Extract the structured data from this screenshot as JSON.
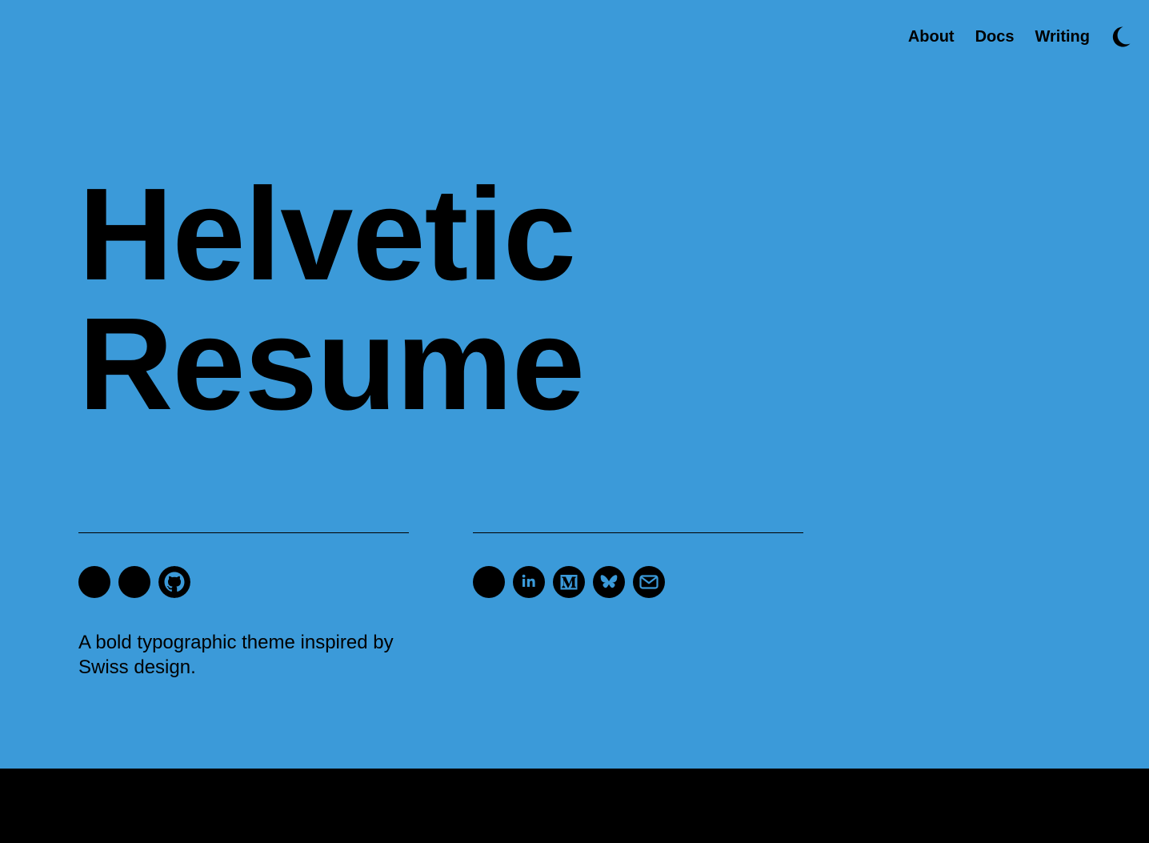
{
  "nav": {
    "items": [
      {
        "label": "About"
      },
      {
        "label": "Docs"
      },
      {
        "label": "Writing"
      }
    ],
    "theme_toggle_icon": "moon-icon"
  },
  "hero": {
    "line1": "Helvetic",
    "line2": "Resume"
  },
  "left_section": {
    "icons": [
      "circle-icon",
      "circle-icon",
      "github-icon"
    ],
    "tagline": "A bold typographic theme inspired by Swiss design."
  },
  "right_section": {
    "icons": [
      "circle-icon",
      "linkedin-icon",
      "medium-icon",
      "bluesky-icon",
      "mail-icon"
    ]
  },
  "colors": {
    "background": "#3b9ad9",
    "text": "#000000",
    "footer": "#000000"
  }
}
